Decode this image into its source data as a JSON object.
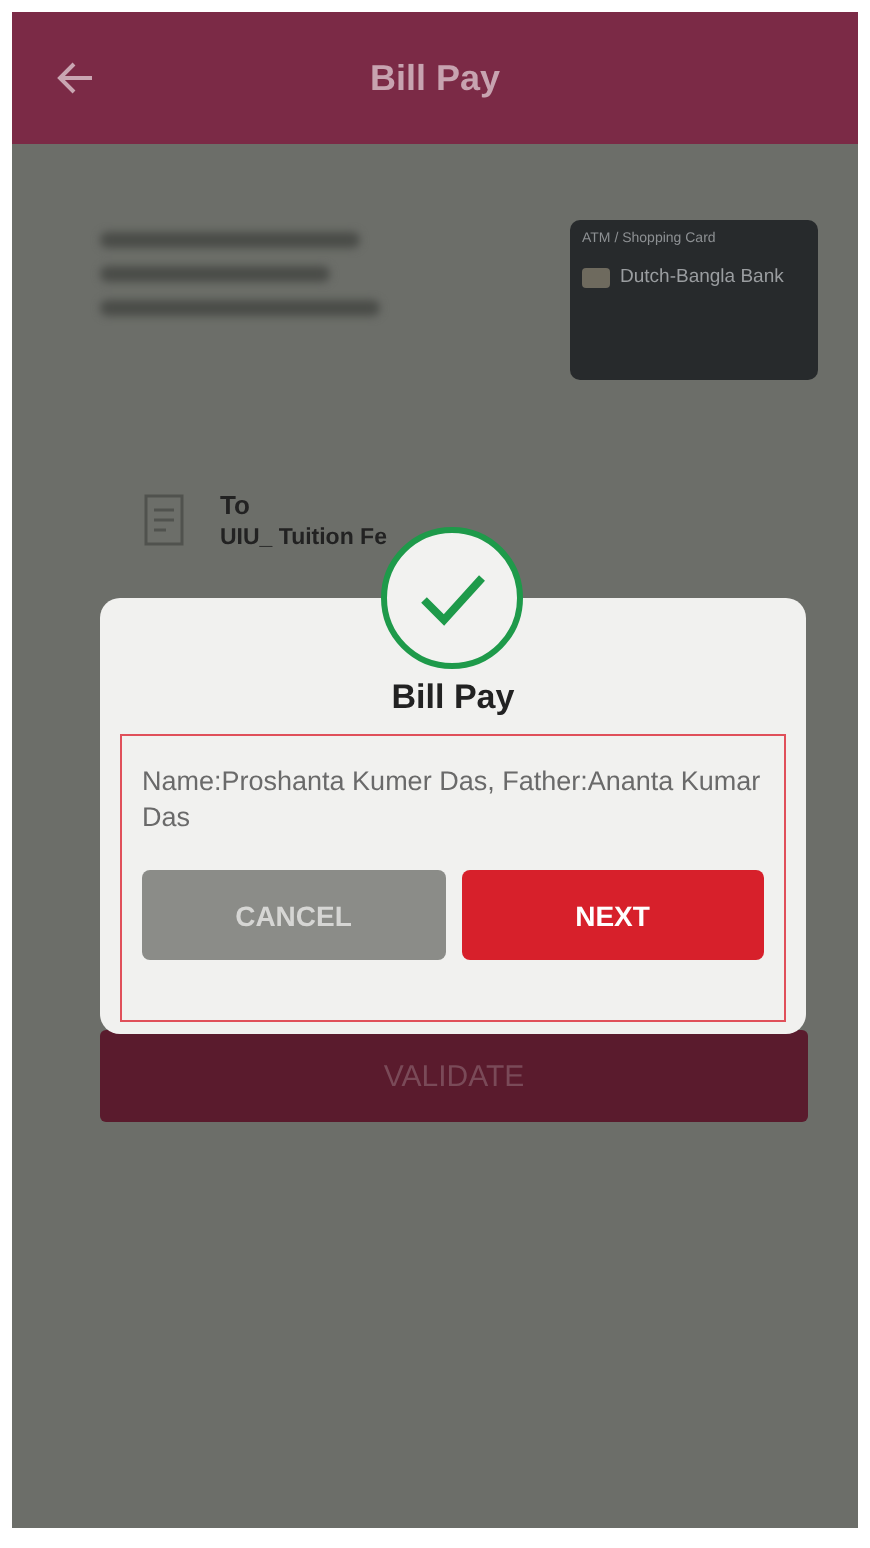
{
  "header": {
    "title": "Bill Pay"
  },
  "card": {
    "type_label": "ATM / Shopping Card",
    "bank": "Dutch-Bangla Bank"
  },
  "recipient": {
    "label": "To",
    "value": "UIU_ Tuition Fe"
  },
  "validate_button": {
    "label": "VALIDATE",
    "disabled": true
  },
  "dialog": {
    "title": "Bill Pay",
    "message": "Name:Proshanta Kumer Das, Father:Ananta Kumar Das",
    "highlighted": true,
    "buttons": [
      {
        "label": "CANCEL",
        "kind": "secondary"
      },
      {
        "label": "NEXT",
        "kind": "primary"
      }
    ]
  }
}
